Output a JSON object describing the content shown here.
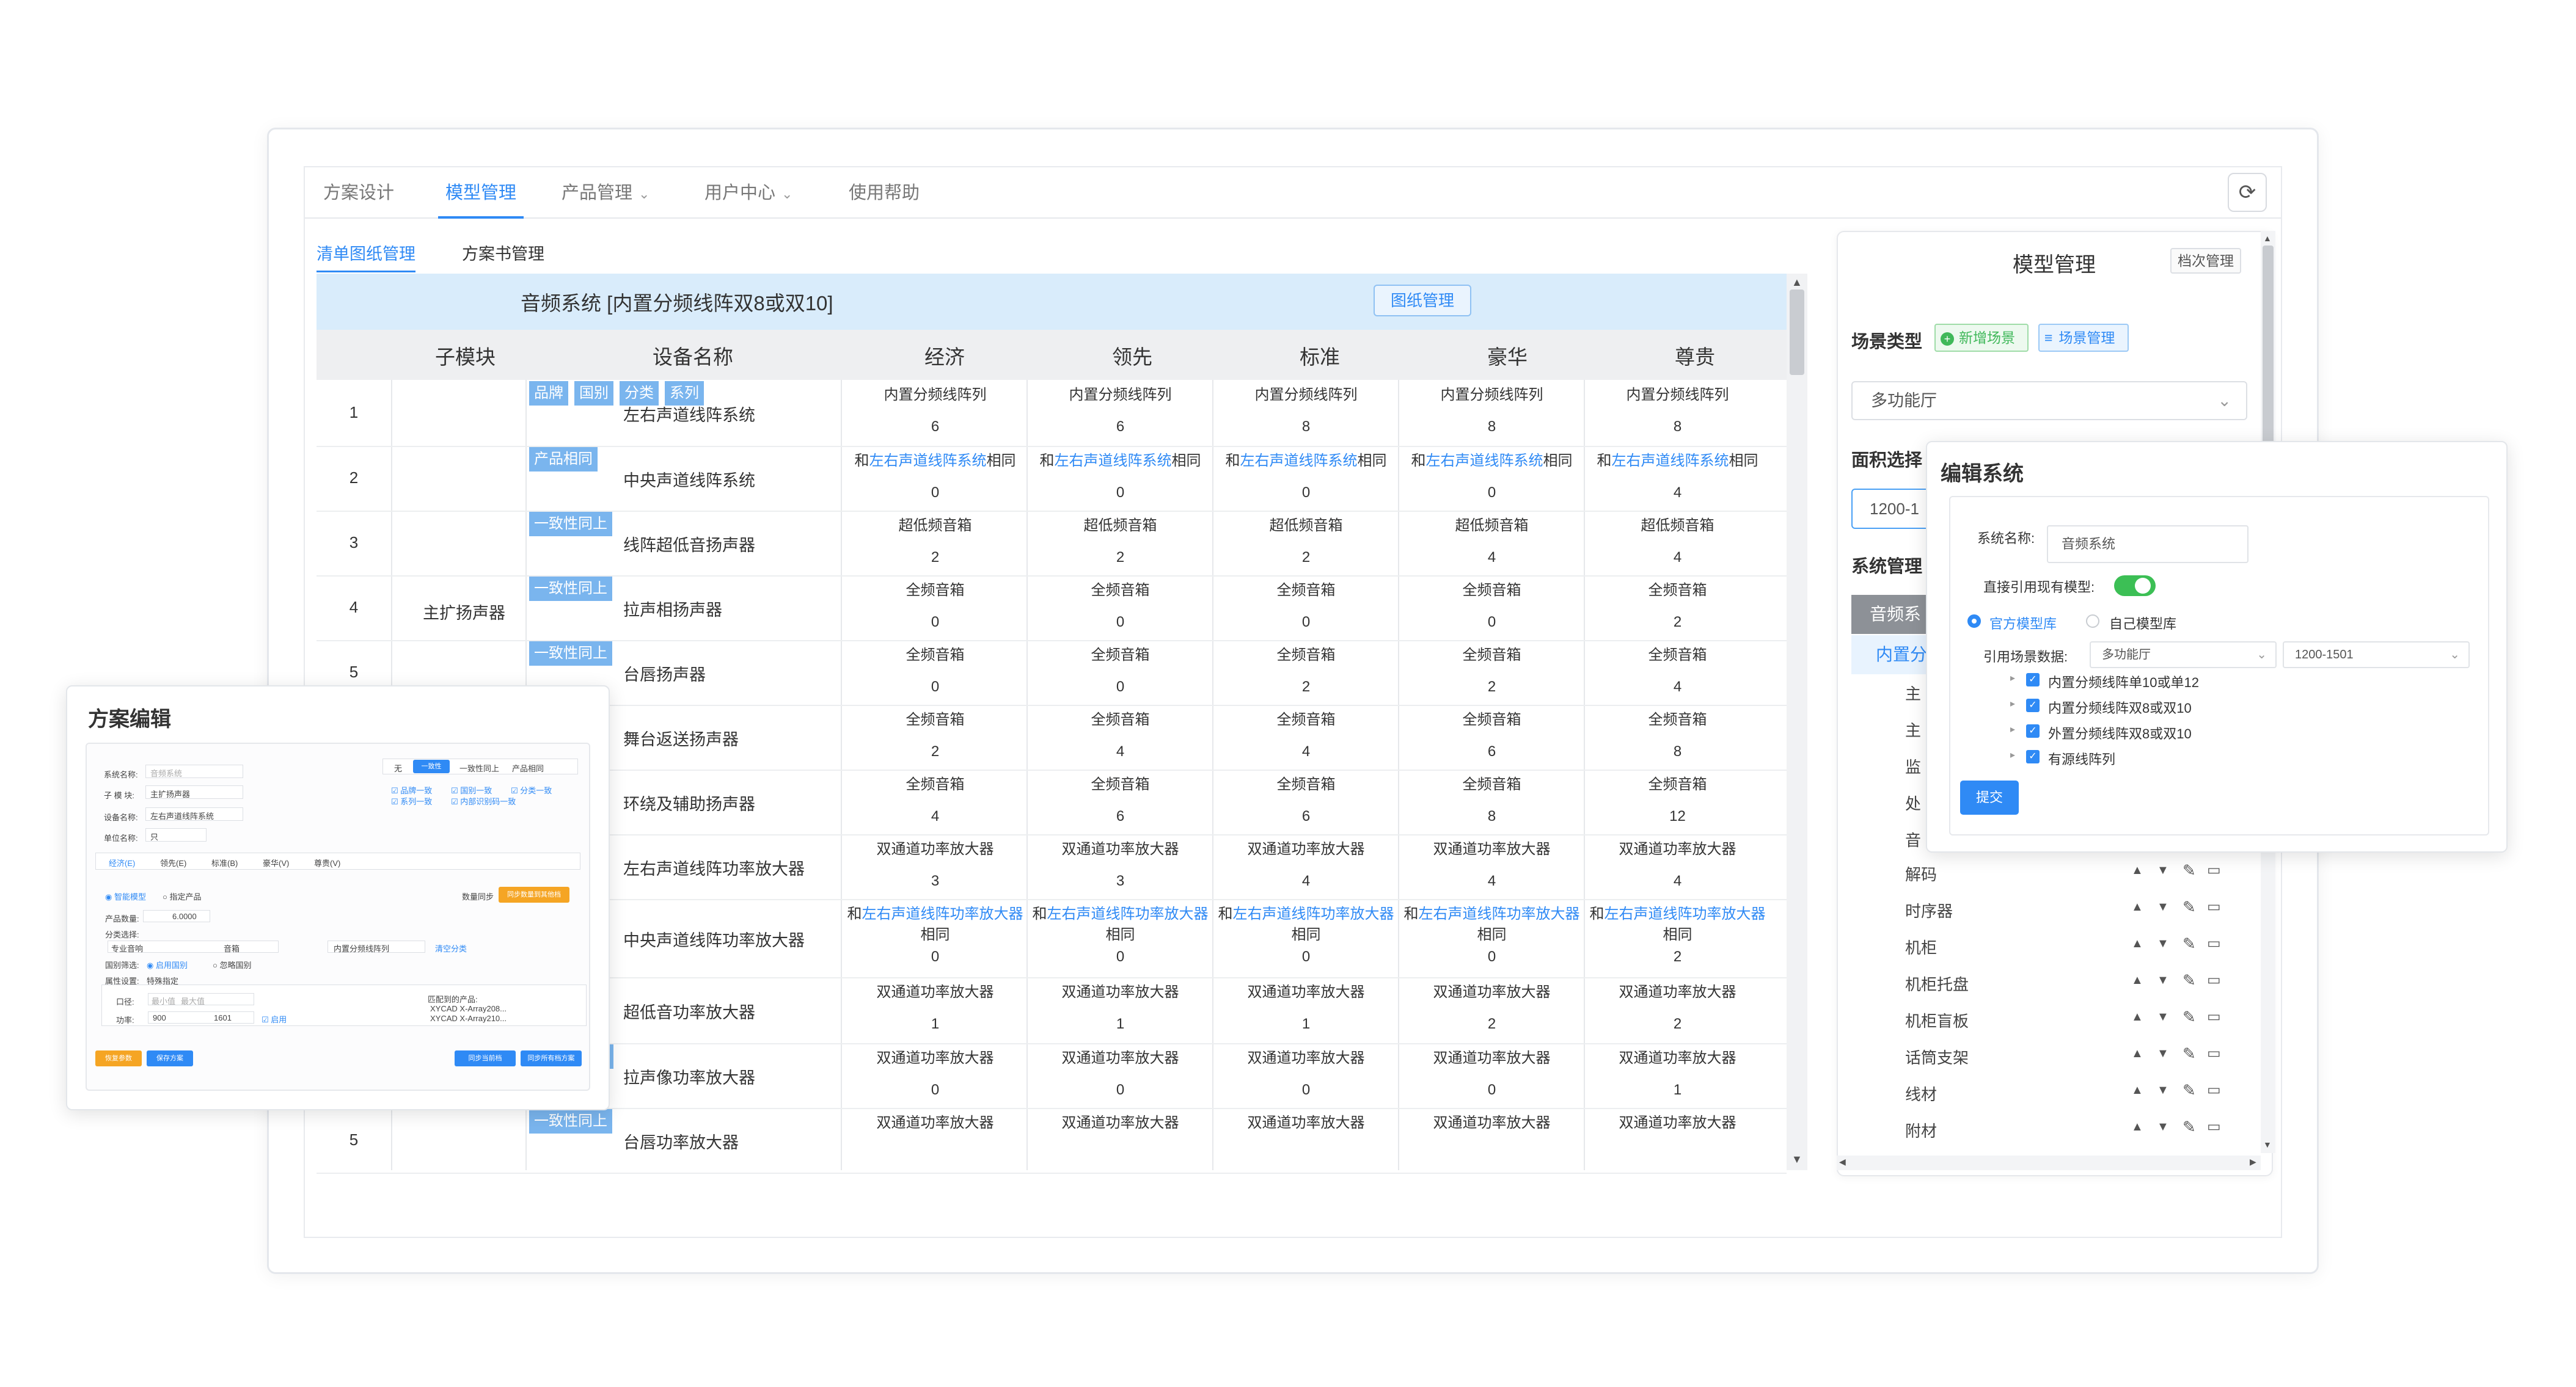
{
  "nav": {
    "items": [
      {
        "label": "方案设计"
      },
      {
        "label": "模型管理"
      },
      {
        "label": "产品管理"
      },
      {
        "label": "用户中心"
      },
      {
        "label": "使用帮助"
      }
    ],
    "active_index": 1
  },
  "subtabs": [
    "清单图纸管理",
    "方案书管理"
  ],
  "table": {
    "system_title": "音频系统 [内置分频线阵双8或双10]",
    "drawing_button": "图纸管理",
    "columns": [
      "子模块",
      "设备名称",
      "经济",
      "领先",
      "标准",
      "豪华",
      "尊贵"
    ],
    "module_label": "主扩扬声器",
    "rows": [
      {
        "num": "1",
        "name": "左右声道线阵系统",
        "tags": [
          "品牌",
          "国别",
          "分类",
          "系列"
        ],
        "cells": [
          [
            "内置分频线阵列",
            "6"
          ],
          [
            "内置分频线阵列",
            "6"
          ],
          [
            "内置分频线阵列",
            "8"
          ],
          [
            "内置分频线阵列",
            "8"
          ],
          [
            "内置分频线阵列",
            "8"
          ]
        ]
      },
      {
        "num": "2",
        "name": "中央声道线阵系统",
        "tags": [
          "产品相同"
        ],
        "cells": [
          [
            "和|左右声道线阵系统|相同",
            "0"
          ],
          [
            "和|左右声道线阵系统|相同",
            "0"
          ],
          [
            "和|左右声道线阵系统|相同",
            "0"
          ],
          [
            "和|左右声道线阵系统|相同",
            "0"
          ],
          [
            "和|左右声道线阵系统|相同",
            "4"
          ]
        ]
      },
      {
        "num": "3",
        "name": "线阵超低音扬声器",
        "tags": [
          "一致性同上"
        ],
        "cells": [
          [
            "超低频音箱",
            "2"
          ],
          [
            "超低频音箱",
            "2"
          ],
          [
            "超低频音箱",
            "2"
          ],
          [
            "超低频音箱",
            "4"
          ],
          [
            "超低频音箱",
            "4"
          ]
        ]
      },
      {
        "num": "4",
        "name": "拉声相扬声器",
        "tags": [
          "一致性同上"
        ],
        "cells": [
          [
            "全频音箱",
            "0"
          ],
          [
            "全频音箱",
            "0"
          ],
          [
            "全频音箱",
            "0"
          ],
          [
            "全频音箱",
            "0"
          ],
          [
            "全频音箱",
            "2"
          ]
        ]
      },
      {
        "num": "5",
        "name": "台唇扬声器",
        "tags": [
          "一致性同上"
        ],
        "cells": [
          [
            "全频音箱",
            "0"
          ],
          [
            "全频音箱",
            "0"
          ],
          [
            "全频音箱",
            "2"
          ],
          [
            "全频音箱",
            "2"
          ],
          [
            "全频音箱",
            "4"
          ]
        ]
      },
      {
        "num": "",
        "name": "舞台返送扬声器",
        "tags": [],
        "cells": [
          [
            "全频音箱",
            "2"
          ],
          [
            "全频音箱",
            "4"
          ],
          [
            "全频音箱",
            "4"
          ],
          [
            "全频音箱",
            "6"
          ],
          [
            "全频音箱",
            "8"
          ]
        ]
      },
      {
        "num": "",
        "name": "环绕及辅助扬声器",
        "tags": [],
        "cells": [
          [
            "全频音箱",
            "4"
          ],
          [
            "全频音箱",
            "6"
          ],
          [
            "全频音箱",
            "6"
          ],
          [
            "全频音箱",
            "8"
          ],
          [
            "全频音箱",
            "12"
          ]
        ]
      },
      {
        "num": "",
        "name": "左右声道线阵功率放大器",
        "tags": [],
        "cells": [
          [
            "双通道功率放大器",
            "3"
          ],
          [
            "双通道功率放大器",
            "3"
          ],
          [
            "双通道功率放大器",
            "4"
          ],
          [
            "双通道功率放大器",
            "4"
          ],
          [
            "双通道功率放大器",
            "4"
          ]
        ]
      },
      {
        "num": "",
        "name": "中央声道线阵功率放大器",
        "tags": [],
        "cells": [
          [
            "和|左右声道线阵功率放大器|相同",
            "0"
          ],
          [
            "和|左右声道线阵功率放大器|相同",
            "0"
          ],
          [
            "和|左右声道线阵功率放大器|相同",
            "0"
          ],
          [
            "和|左右声道线阵功率放大器|相同",
            "0"
          ],
          [
            "和|左右声道线阵功率放大器|相同",
            "2"
          ]
        ]
      },
      {
        "num": "",
        "name": "超低音功率放大器",
        "tags": [],
        "cells": [
          [
            "双通道功率放大器",
            "1"
          ],
          [
            "双通道功率放大器",
            "1"
          ],
          [
            "双通道功率放大器",
            "1"
          ],
          [
            "双通道功率放大器",
            "2"
          ],
          [
            "双通道功率放大器",
            "2"
          ]
        ]
      },
      {
        "num": "",
        "name": "拉声像功率放大器",
        "tags": [
          "国别",
          "系列"
        ],
        "cells": [
          [
            "双通道功率放大器",
            "0"
          ],
          [
            "双通道功率放大器",
            "0"
          ],
          [
            "双通道功率放大器",
            "0"
          ],
          [
            "双通道功率放大器",
            "0"
          ],
          [
            "双通道功率放大器",
            "1"
          ]
        ]
      },
      {
        "num": "5",
        "name": "台唇功率放大器",
        "tags": [
          "一致性同上"
        ],
        "cells": [
          [
            "双通道功率放大器",
            ""
          ],
          [
            "双通道功率放大器",
            ""
          ],
          [
            "双通道功率放大器",
            ""
          ],
          [
            "双通道功率放大器",
            ""
          ],
          [
            "双通道功率放大器",
            ""
          ]
        ]
      }
    ]
  },
  "right_panel": {
    "title": "模型管理",
    "archive_button": "档次管理",
    "scene_label": "场景类型",
    "add_scene": "新增场景",
    "manage_scene": "场景管理",
    "scene_value": "多功能厅",
    "area_label": "面积选择",
    "area_value": "1200-1",
    "system_label": "系统管理",
    "system_active": "音频系",
    "system_sub": "内置分",
    "partial_items": [
      "主",
      "主",
      "监",
      "处",
      "音"
    ],
    "items": [
      "解码",
      "时序器",
      "机柜",
      "机柜托盘",
      "机柜盲板",
      "话筒支架",
      "线材",
      "附材"
    ]
  },
  "edit_dialog": {
    "title": "编辑系统",
    "name_label": "系统名称:",
    "name_value": "音频系统",
    "direct_ref_label": "直接引用现有模型:",
    "radio_official": "官方模型库",
    "radio_own": "自己模型库",
    "ref_scene_label": "引用场景数据:",
    "ref_scene_value": "多功能厅",
    "ref_area_value": "1200-1501",
    "tree": [
      "内置分频线阵单10或单12",
      "内置分频线阵双8或双10",
      "外置分频线阵双8或双10",
      "有源线阵列"
    ],
    "submit": "提交"
  },
  "plan_dialog": {
    "title": "方案编辑",
    "fields": [
      {
        "label": "系统名称:",
        "value": "音频系统"
      },
      {
        "label": "子 模 块:",
        "value": "主扩扬声器"
      },
      {
        "label": "设备名称:",
        "value": "左右声道线阵系统"
      },
      {
        "label": "单位名称:",
        "value": "只"
      }
    ],
    "mode_tabs": [
      "无",
      "一致性",
      "一致性同上",
      "产品相同"
    ],
    "checks": [
      "品牌一致",
      "国别一致",
      "分类一致",
      "系列一致",
      "内部识别码一致"
    ],
    "grade_tabs": [
      "经济(E)",
      "领先(E)",
      "标准(B)",
      "豪华(V)",
      "尊贵(V)"
    ],
    "radio_smart": "智能模型",
    "radio_fixed": "指定产品",
    "count_sync": "数量同步",
    "sync_button": "同步数量到其他档",
    "qty_label": "产品数量:",
    "qty_value": "6.0000",
    "class_label": "分类选择:",
    "class_values": [
      "专业音响",
      "音箱",
      "内置分频线阵列"
    ],
    "clear_class": "清空分类",
    "bg_filter_label": "国别筛选:",
    "bg_filter_values": [
      "启用国别",
      "忽略国别"
    ],
    "prop_label": "属性设置:",
    "prop_value": "特殊指定",
    "size_label": "口径:",
    "power_label": "功率:",
    "size_values": [
      "最小值",
      "最大值"
    ],
    "power_values": [
      "900",
      "1601"
    ],
    "enable_label": "启用",
    "matched_label": "匹配到的产品:",
    "matched": [
      "XYCAD X-Array208...",
      "XYCAD X-Array210..."
    ],
    "btn_keep": "恢复参数",
    "btn_save": "保存方案",
    "btn_sync_all": "同步当前档",
    "btn_sync_other": "同步所有档方案"
  }
}
